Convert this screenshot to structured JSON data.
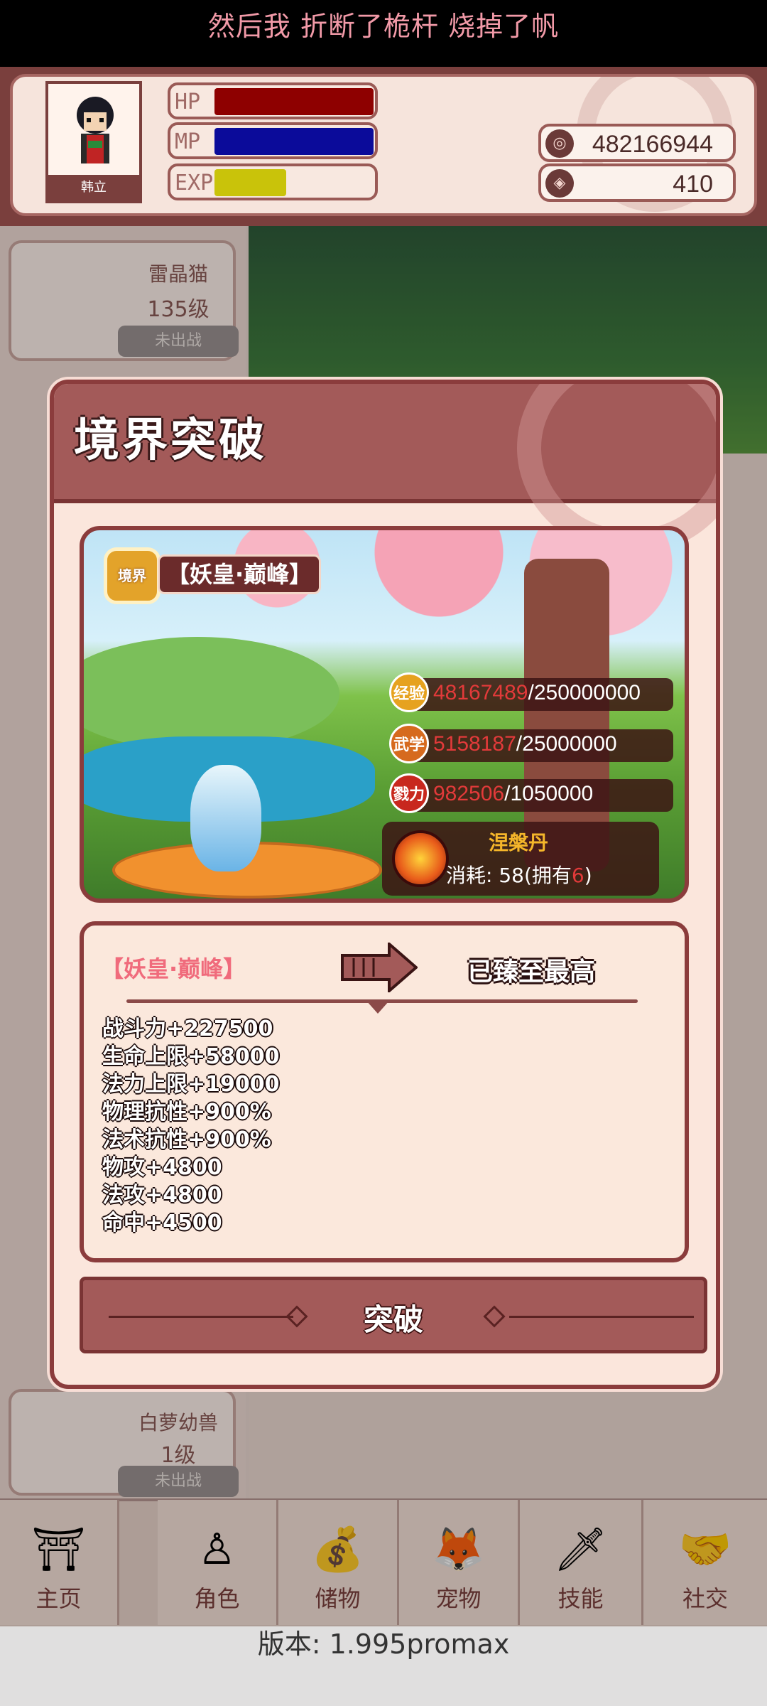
{
  "lyric": "然后我 折断了桅杆 烧掉了帆",
  "player": {
    "name": "韩立",
    "hp_label": "HP",
    "mp_label": "MP",
    "exp_label": "EXP",
    "hp_fill": 1.0,
    "mp_fill": 1.0,
    "exp_fill": 0.45,
    "coins": "482166944",
    "gems": "410"
  },
  "pets": [
    {
      "name": "雷晶猫",
      "level": "135级",
      "status": "未出战"
    },
    {
      "name": "白萝幼兽",
      "level": "1级",
      "status": "未出战"
    }
  ],
  "modal": {
    "title": "境界突破",
    "badge": "境界",
    "realm": "【妖皇·巅峰】",
    "resources": [
      {
        "icon": "经验",
        "current": "48167489",
        "max": "/250000000",
        "color": "#e6a21f"
      },
      {
        "icon": "武学",
        "current": "5158187",
        "max": "/25000000",
        "color": "#d66a1e"
      },
      {
        "icon": "戮力",
        "current": "982506",
        "max": "/1050000",
        "color": "#c8281e"
      }
    ],
    "pill": {
      "name": "涅槃丹",
      "cost_prefix": "消耗: 58(拥有",
      "owned": "6",
      "cost_suffix": ")"
    },
    "from_realm": "【妖皇·巅峰】",
    "to_realm": "已臻至最高",
    "bonuses": [
      "战斗力+227500",
      "生命上限+58000",
      "法力上限+19000",
      "物理抗性+900%",
      "法术抗性+900%",
      "物攻+4800",
      "法攻+4800",
      "命中+4500"
    ],
    "button": "突破"
  },
  "nav": [
    {
      "label": "主页",
      "icon": "⛩"
    },
    {
      "label": "角色",
      "icon": "♙"
    },
    {
      "label": "储物",
      "icon": "💰"
    },
    {
      "label": "宠物",
      "icon": "🦊"
    },
    {
      "label": "技能",
      "icon": "🗡"
    },
    {
      "label": "社交",
      "icon": "🤝"
    }
  ],
  "version": "版本: 1.995promax"
}
